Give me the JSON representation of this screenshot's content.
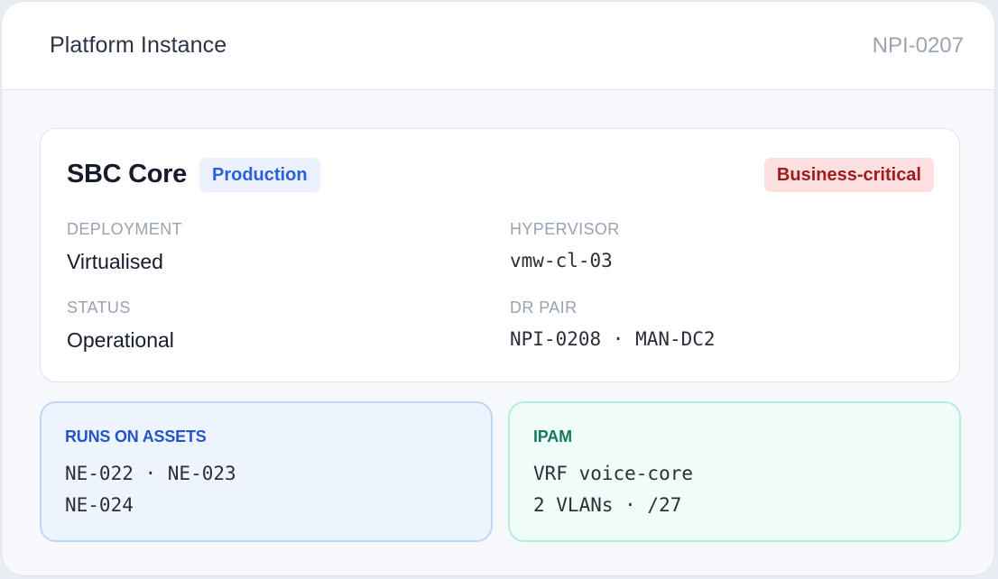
{
  "header": {
    "title": "Platform Instance",
    "id": "NPI-0207"
  },
  "instance": {
    "name": "SBC Core",
    "environment": "Production",
    "criticality": "Business-critical",
    "fields": {
      "deployment": {
        "label": "DEPLOYMENT",
        "value": "Virtualised"
      },
      "hypervisor": {
        "label": "HYPERVISOR",
        "value": "vmw-cl-03"
      },
      "status": {
        "label": "STATUS",
        "value": "Operational"
      },
      "dr_pair": {
        "label": "DR PAIR",
        "value": "NPI-0208 · MAN-DC2"
      }
    }
  },
  "assets": {
    "label": "RUNS ON ASSETS",
    "lines": [
      "NE-022 · NE-023",
      "NE-024"
    ]
  },
  "ipam": {
    "label": "IPAM",
    "lines": [
      "VRF voice-core",
      "2 VLANs · /27"
    ]
  },
  "colors": {
    "environment_badge_bg": "#eaf1fd",
    "environment_badge_text": "#2a62d6",
    "critical_badge_bg": "#fbe0df",
    "critical_badge_text": "#a21c1c",
    "assets_accent": "#2455c7",
    "ipam_accent": "#127a60"
  }
}
